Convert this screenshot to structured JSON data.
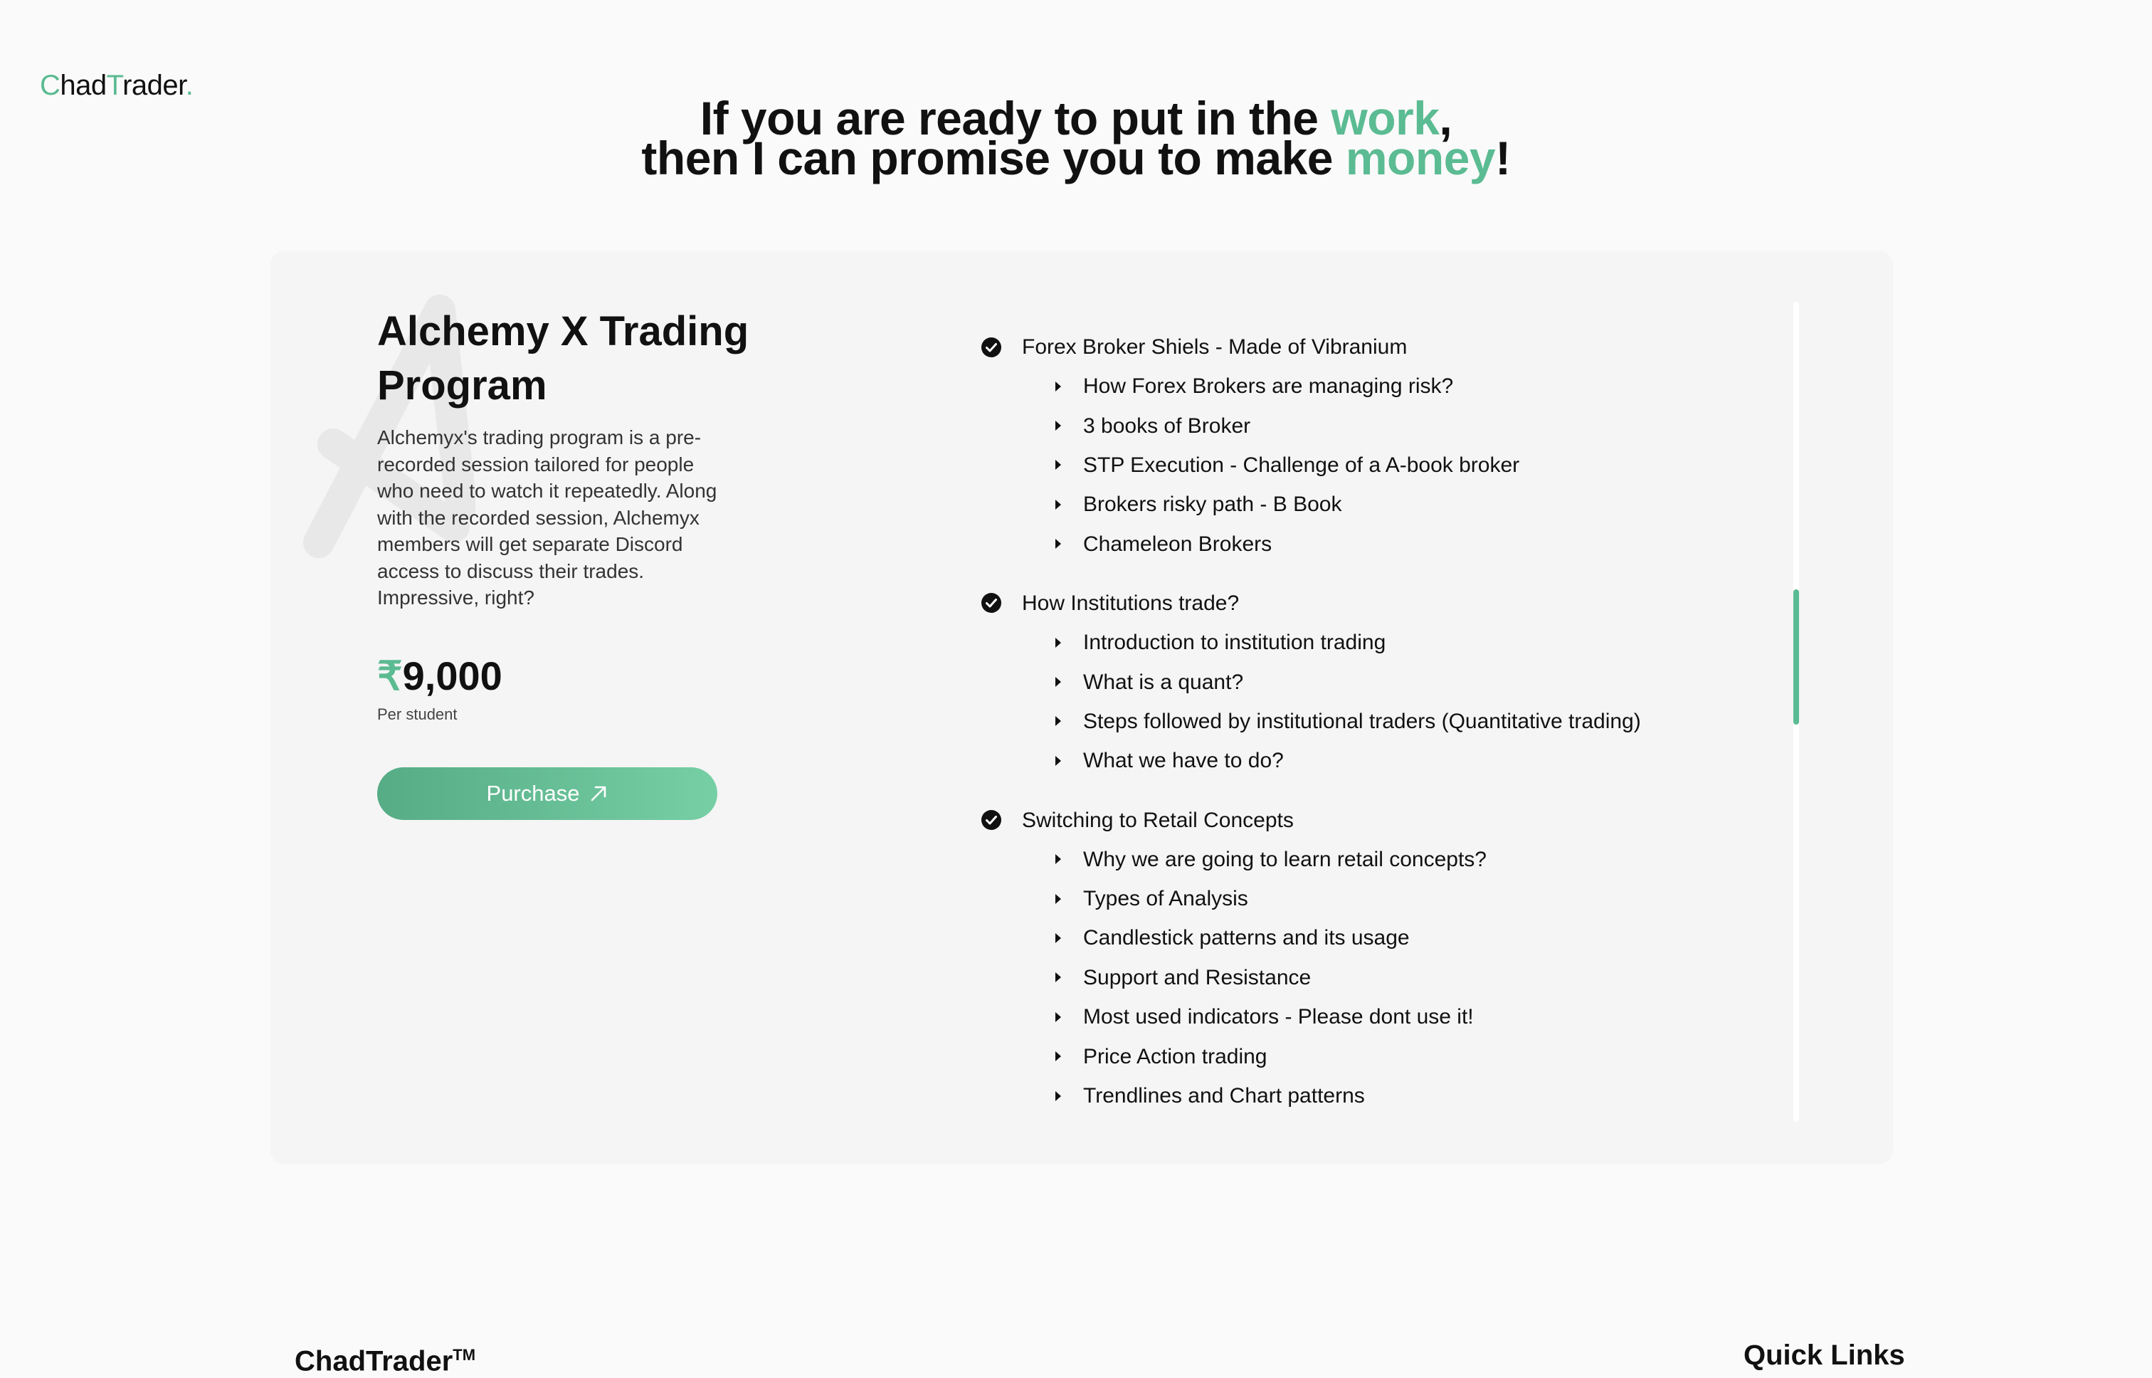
{
  "header": {
    "logo": {
      "c": "C",
      "had": "had",
      "t": "T",
      "rader": "rader",
      "dot": "."
    }
  },
  "hero": {
    "line1_prefix": "If you are ready to put in the ",
    "line1_accent": "work",
    "line1_suffix": ",",
    "line2_prefix": "then I can promise you to make ",
    "line2_accent": "money",
    "line2_suffix": "!"
  },
  "program": {
    "title": "Alchemy X Trading Program",
    "description": "Alchemyx's trading program is a pre-recorded session tailored for people who need to watch it repeatedly. Along with the recorded session, Alchemyx members will get separate Discord access to discuss their trades. Impressive, right?",
    "currency": "₹",
    "price": "9,000",
    "price_note": "Per student",
    "purchase_label": "Purchase",
    "purchase_icon": "arrow-up-right-icon"
  },
  "curriculum": {
    "modules": [
      {
        "title": "Forex Broker Shiels - Made of Vibranium",
        "lessons": [
          "How Forex Brokers are managing risk?",
          "3 books of Broker",
          "STP Execution - Challenge of a A-book broker",
          "Brokers risky path - B Book",
          "Chameleon Brokers"
        ]
      },
      {
        "title": "How Institutions trade?",
        "lessons": [
          "Introduction to institution trading",
          "What is a quant?",
          "Steps followed by institutional traders (Quantitative trading)",
          "What we have to do?"
        ]
      },
      {
        "title": "Switching to Retail Concepts",
        "lessons": [
          "Why we are going to learn retail concepts?",
          "Types of Analysis",
          "Candlestick patterns and its usage",
          "Support and Resistance",
          "Most used indicators - Please dont use it!",
          "Price Action trading",
          "Trendlines and Chart patterns"
        ]
      }
    ]
  },
  "footer": {
    "brand": "ChadTrader",
    "brand_mark": "TM",
    "quick_links_heading": "Quick Links"
  },
  "colors": {
    "accent": "#5bbb92",
    "card_background": "#f5f5f5",
    "page_background": "#fafafa"
  }
}
